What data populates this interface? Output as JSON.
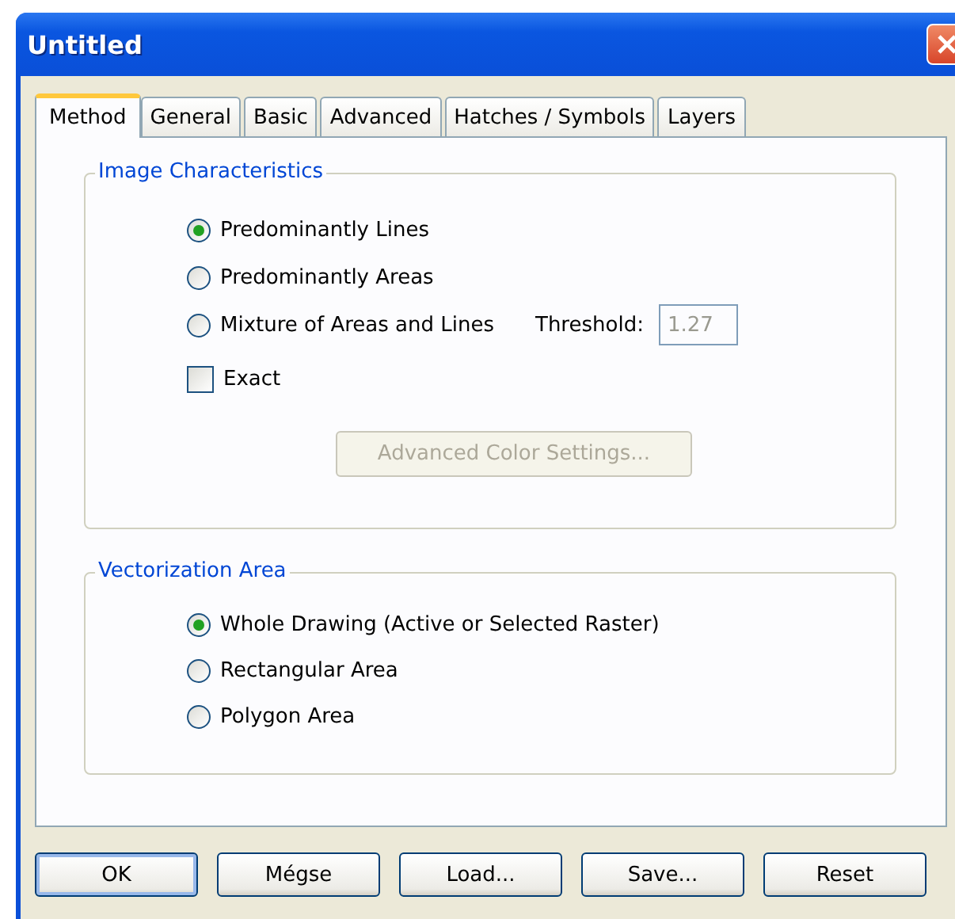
{
  "window": {
    "title": "Untitled"
  },
  "tabs": [
    {
      "label": "Method",
      "selected": true
    },
    {
      "label": "General",
      "selected": false
    },
    {
      "label": "Basic",
      "selected": false
    },
    {
      "label": "Advanced",
      "selected": false
    },
    {
      "label": "Hatches / Symbols",
      "selected": false
    },
    {
      "label": "Layers",
      "selected": false
    }
  ],
  "image_characteristics": {
    "title": "Image Characteristics",
    "options": [
      {
        "label": "Predominantly Lines",
        "selected": true
      },
      {
        "label": "Predominantly Areas",
        "selected": false
      },
      {
        "label": "Mixture of Areas and Lines",
        "selected": false
      }
    ],
    "threshold": {
      "label": "Threshold:",
      "value": "1.27",
      "disabled": true
    },
    "exact": {
      "label": "Exact",
      "checked": false
    },
    "color_button": {
      "label": "Advanced Color Settings...",
      "disabled": true
    }
  },
  "vectorization_area": {
    "title": "Vectorization Area",
    "options": [
      {
        "label": "Whole Drawing (Active or Selected Raster)",
        "selected": true
      },
      {
        "label": "Rectangular Area",
        "selected": false
      },
      {
        "label": "Polygon Area",
        "selected": false
      }
    ]
  },
  "buttons": [
    {
      "label": "OK",
      "default": true
    },
    {
      "label": "Mégse",
      "default": false
    },
    {
      "label": "Load...",
      "default": false
    },
    {
      "label": "Save...",
      "default": false
    },
    {
      "label": "Reset",
      "default": false
    }
  ]
}
